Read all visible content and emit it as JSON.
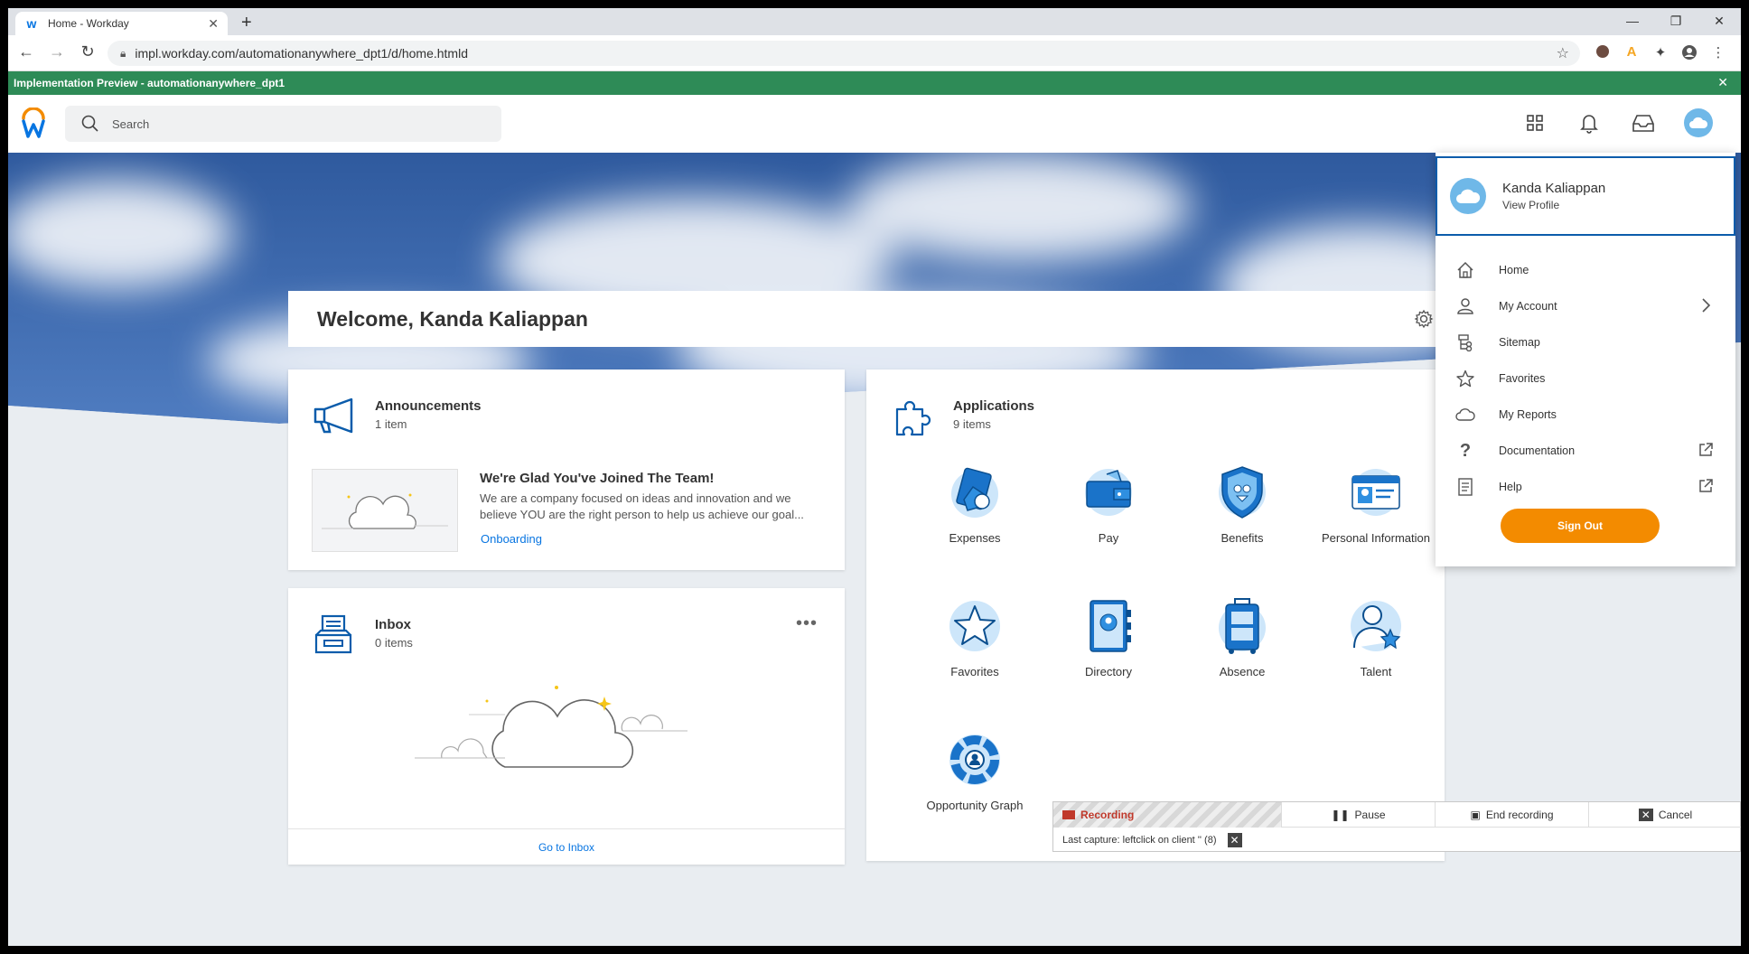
{
  "browser": {
    "tab_title": "Home - Workday",
    "tab_close": "✕",
    "new_tab": "+",
    "url": "impl.workday.com/automationanywhere_dpt1/d/home.htmld",
    "banner": "Implementation Preview - automationanywhere_dpt1",
    "banner_close": "✕"
  },
  "header": {
    "search_placeholder": "Search"
  },
  "welcome": {
    "title": "Welcome, Kanda Kaliappan"
  },
  "announcements": {
    "title": "Announcements",
    "count": "1 item",
    "item_title": "We're Glad You've Joined The Team!",
    "item_desc": "We are a company focused on ideas and innovation and we believe YOU are the right person to help us achieve our goal...",
    "item_link": "Onboarding"
  },
  "inbox": {
    "title": "Inbox",
    "count": "0 items",
    "more": "•••",
    "footer_link": "Go to Inbox"
  },
  "applications": {
    "title": "Applications",
    "count": "9 items",
    "items": [
      {
        "label": "Expenses",
        "icon": "expenses-icon"
      },
      {
        "label": "Pay",
        "icon": "wallet-icon"
      },
      {
        "label": "Benefits",
        "icon": "shield-icon"
      },
      {
        "label": "Personal Information",
        "icon": "id-card-icon"
      },
      {
        "label": "Favorites",
        "icon": "star-icon"
      },
      {
        "label": "Directory",
        "icon": "directory-icon"
      },
      {
        "label": "Absence",
        "icon": "suitcase-icon"
      },
      {
        "label": "Talent",
        "icon": "person-star-icon"
      },
      {
        "label": "Opportunity Graph",
        "icon": "opportunity-graph-icon"
      }
    ]
  },
  "profile_menu": {
    "name": "Kanda Kaliappan",
    "view_profile": "View Profile",
    "items": [
      {
        "label": "Home",
        "icon": "home-icon"
      },
      {
        "label": "My Account",
        "icon": "user-icon"
      },
      {
        "label": "Sitemap",
        "icon": "sitemap-icon"
      },
      {
        "label": "Favorites",
        "icon": "star-outline-icon"
      },
      {
        "label": "My Reports",
        "icon": "cloud-outline-icon"
      },
      {
        "label": "Documentation",
        "icon": "question-icon"
      },
      {
        "label": "Help",
        "icon": "document-icon"
      }
    ],
    "sign_out": "Sign Out"
  },
  "recorder": {
    "status": "Recording",
    "pause": "Pause",
    "end": "End recording",
    "cancel": "Cancel",
    "last_capture": "Last capture: leftclick on client '' (8)"
  },
  "colors": {
    "brand_blue": "#0875e1",
    "banner_green": "#2e8b57",
    "sign_out_orange": "#f38b00",
    "profile_border": "#0b5cab"
  }
}
